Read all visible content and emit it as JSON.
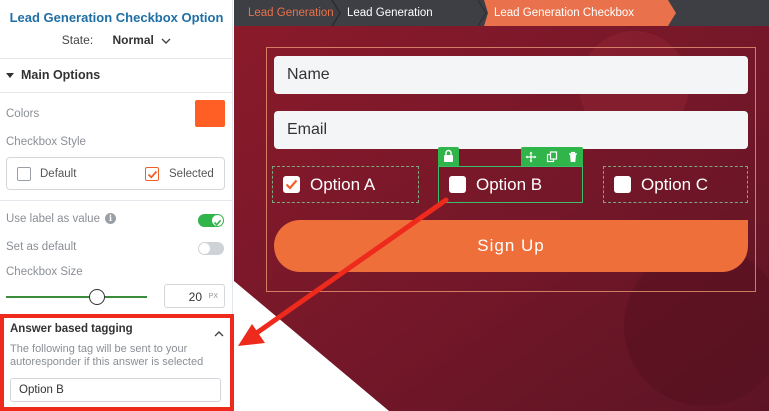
{
  "panel": {
    "title": "Lead Generation Checkbox Option",
    "state_label": "State:",
    "state_value": "Normal",
    "section_title": "Main Options",
    "colors_label": "Colors",
    "colors_value": "#ff5f24",
    "checkbox_style_label": "Checkbox Style",
    "style_default_label": "Default",
    "style_selected_label": "Selected",
    "use_label_as_value_label": "Use label as value",
    "use_label_as_value_on": true,
    "set_as_default_label": "Set as default",
    "set_as_default_on": false,
    "checkbox_size_label": "Checkbox Size",
    "checkbox_size_value": "20",
    "checkbox_size_unit": "PX",
    "tagging": {
      "title": "Answer based tagging",
      "description": "The following tag will be sent to your autoresponder if this answer is selected",
      "tag_value": "Option B"
    }
  },
  "breadcrumb": {
    "items": [
      "Lead Generation",
      "Lead Generation Checkbox",
      "Lead Generation Checkbox Option"
    ]
  },
  "canvas": {
    "name_placeholder": "Name",
    "email_placeholder": "Email",
    "options": [
      {
        "label": "Option A",
        "checked": true
      },
      {
        "label": "Option B",
        "checked": false
      },
      {
        "label": "Option C",
        "checked": false
      }
    ],
    "submit_label": "Sign Up"
  },
  "colors": {
    "accent": "#ef6f3b",
    "toggle_on": "#2fb54a",
    "highlight": "#ee2a1c",
    "title_blue": "#1e6fa6"
  }
}
